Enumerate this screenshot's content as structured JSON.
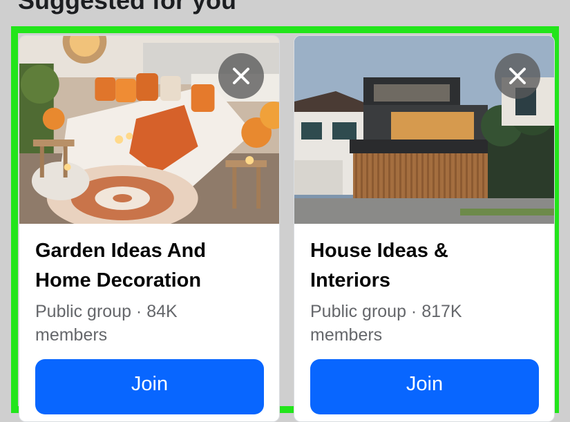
{
  "section": {
    "title": "Suggested for you"
  },
  "cards": [
    {
      "title_line1": "Garden Ideas And",
      "title_line2": "Home Decoration",
      "meta_line1": "Public group · 84K",
      "meta_line2": "members",
      "join_label": "Join",
      "dismiss_icon": "close-icon"
    },
    {
      "title_line1": "House Ideas &",
      "title_line2": "Interiors",
      "meta_line1": "Public group · 817K",
      "meta_line2": "members",
      "join_label": "Join",
      "dismiss_icon": "close-icon"
    }
  ],
  "colors": {
    "highlight": "#22e51b",
    "join_button": "#0866ff",
    "title_text": "#050505",
    "meta_text": "#65676b"
  }
}
